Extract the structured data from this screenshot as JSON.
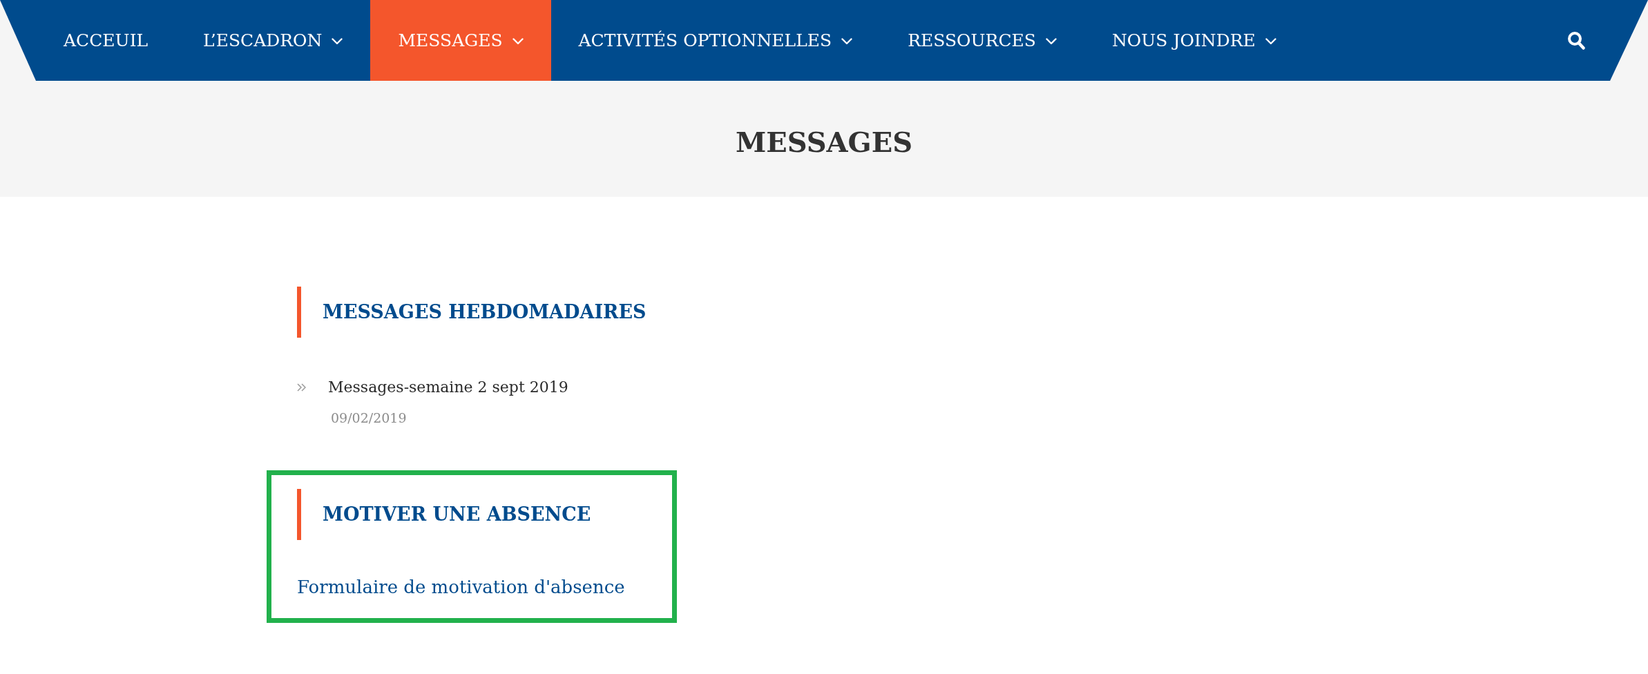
{
  "nav": {
    "items": [
      {
        "label": "ACCEUIL",
        "has_submenu": false,
        "selected": false
      },
      {
        "label": "L’ESCADRON",
        "has_submenu": true,
        "selected": false
      },
      {
        "label": "MESSAGES",
        "has_submenu": true,
        "selected": true
      },
      {
        "label": "ACTIVITÉS OPTIONNELLES",
        "has_submenu": true,
        "selected": false
      },
      {
        "label": "RESSOURCES",
        "has_submenu": true,
        "selected": false
      },
      {
        "label": "NOUS JOINDRE",
        "has_submenu": true,
        "selected": false
      }
    ]
  },
  "page_title": "MESSAGES",
  "sections": [
    {
      "heading": "MESSAGES HEBDOMADAIRES",
      "highlighted": false,
      "kind": "posts",
      "posts": [
        {
          "title": "Messages-semaine 2 sept 2019",
          "date": "09/02/2019"
        }
      ]
    },
    {
      "heading": "MOTIVER UNE ABSENCE",
      "highlighted": true,
      "kind": "links",
      "links": [
        "Formulaire de motivation d'absence"
      ]
    }
  ]
}
